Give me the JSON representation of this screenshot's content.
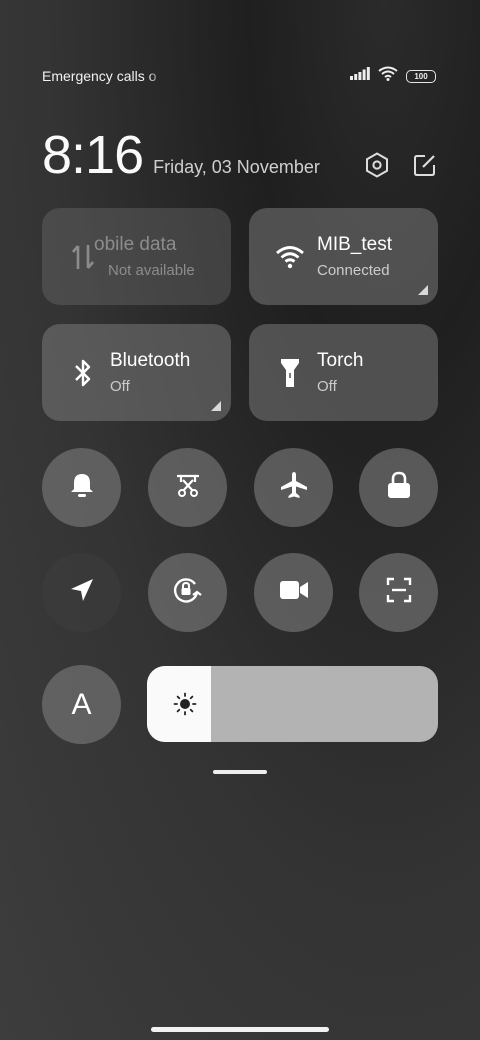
{
  "status_bar": {
    "carrier_text": "Emergency calls o",
    "battery_level": "100",
    "icons": [
      "signal-icon",
      "wifi-icon",
      "battery-icon"
    ]
  },
  "header": {
    "time": "8:16",
    "date": "Friday, 03 November",
    "icons": [
      "settings-icon",
      "edit-icon"
    ]
  },
  "tiles": [
    {
      "title": "obile data",
      "subtitle": "Not available",
      "icon": "mobile-data-icon",
      "state": "disabled"
    },
    {
      "title": "MIB_test",
      "subtitle": "Connected",
      "icon": "wifi-icon",
      "state": "on"
    },
    {
      "title": "Bluetooth",
      "subtitle": "Off",
      "icon": "bluetooth-icon",
      "state": "off"
    },
    {
      "title": "Torch",
      "subtitle": "Off",
      "icon": "torch-icon",
      "state": "off"
    }
  ],
  "toggles_row1": [
    "bell-icon",
    "screenshot-icon",
    "airplane-icon",
    "lock-icon"
  ],
  "toggles_row2": [
    "location-icon",
    "rotation-lock-icon",
    "video-icon",
    "scanner-icon"
  ],
  "auto_brightness_label": "A",
  "brightness": {
    "level": 0.22,
    "icon": "sun-icon"
  },
  "colors": {
    "tile": "#7a7a7a",
    "slider_fill": "#fafafa",
    "slider_track": "#b3b3b3"
  }
}
